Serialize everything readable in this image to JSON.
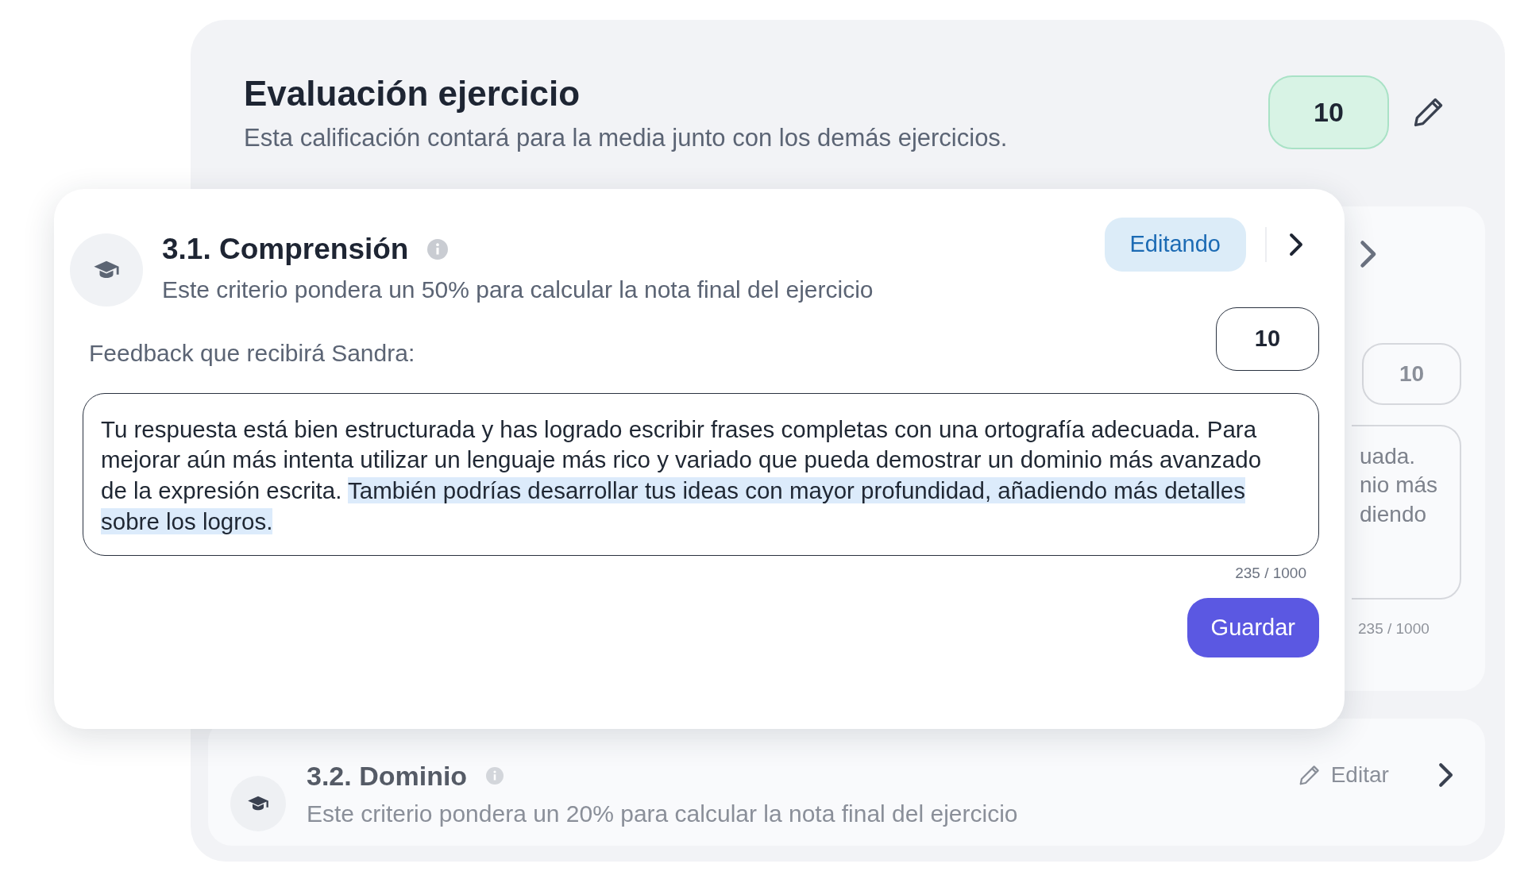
{
  "header": {
    "title": "Evaluación ejercicio",
    "subtitle": "Esta calificación contará para la media junto con los demás ejercicios.",
    "score": "10"
  },
  "background_copy": {
    "score": "10",
    "feedback_fragments": [
      "uada.",
      "nio más",
      "diendo"
    ],
    "counter": "235 / 1000"
  },
  "criteria": [
    {
      "kind": "editing",
      "title": "3.1. Comprensión",
      "description": "Este criterio pondera un 50% para calcular la nota final del ejercicio",
      "status": "Editando",
      "score": "10",
      "feedback_label": "Feedback que recibirá Sandra:",
      "feedback": [
        {
          "text": "Tu respuesta está bien estructurada y has logrado escribir frases completas con una ortografía adecuada. Para mejorar aún más intenta utilizar un lenguaje más rico y variado que pueda demostrar un dominio más avanzado de la expresión escrita. ",
          "highlighted": false
        },
        {
          "text": "También podrías desarrollar tus ideas con mayor profundidad, añadiendo más detalles sobre los logros.",
          "highlighted": true
        }
      ],
      "counter": "235 / 1000",
      "save": "Guardar"
    },
    {
      "kind": "collapsed",
      "title": "3.2. Dominio",
      "description": "Este criterio pondera un 20% para calcular la nota final del ejercicio",
      "action": "Editar"
    }
  ]
}
